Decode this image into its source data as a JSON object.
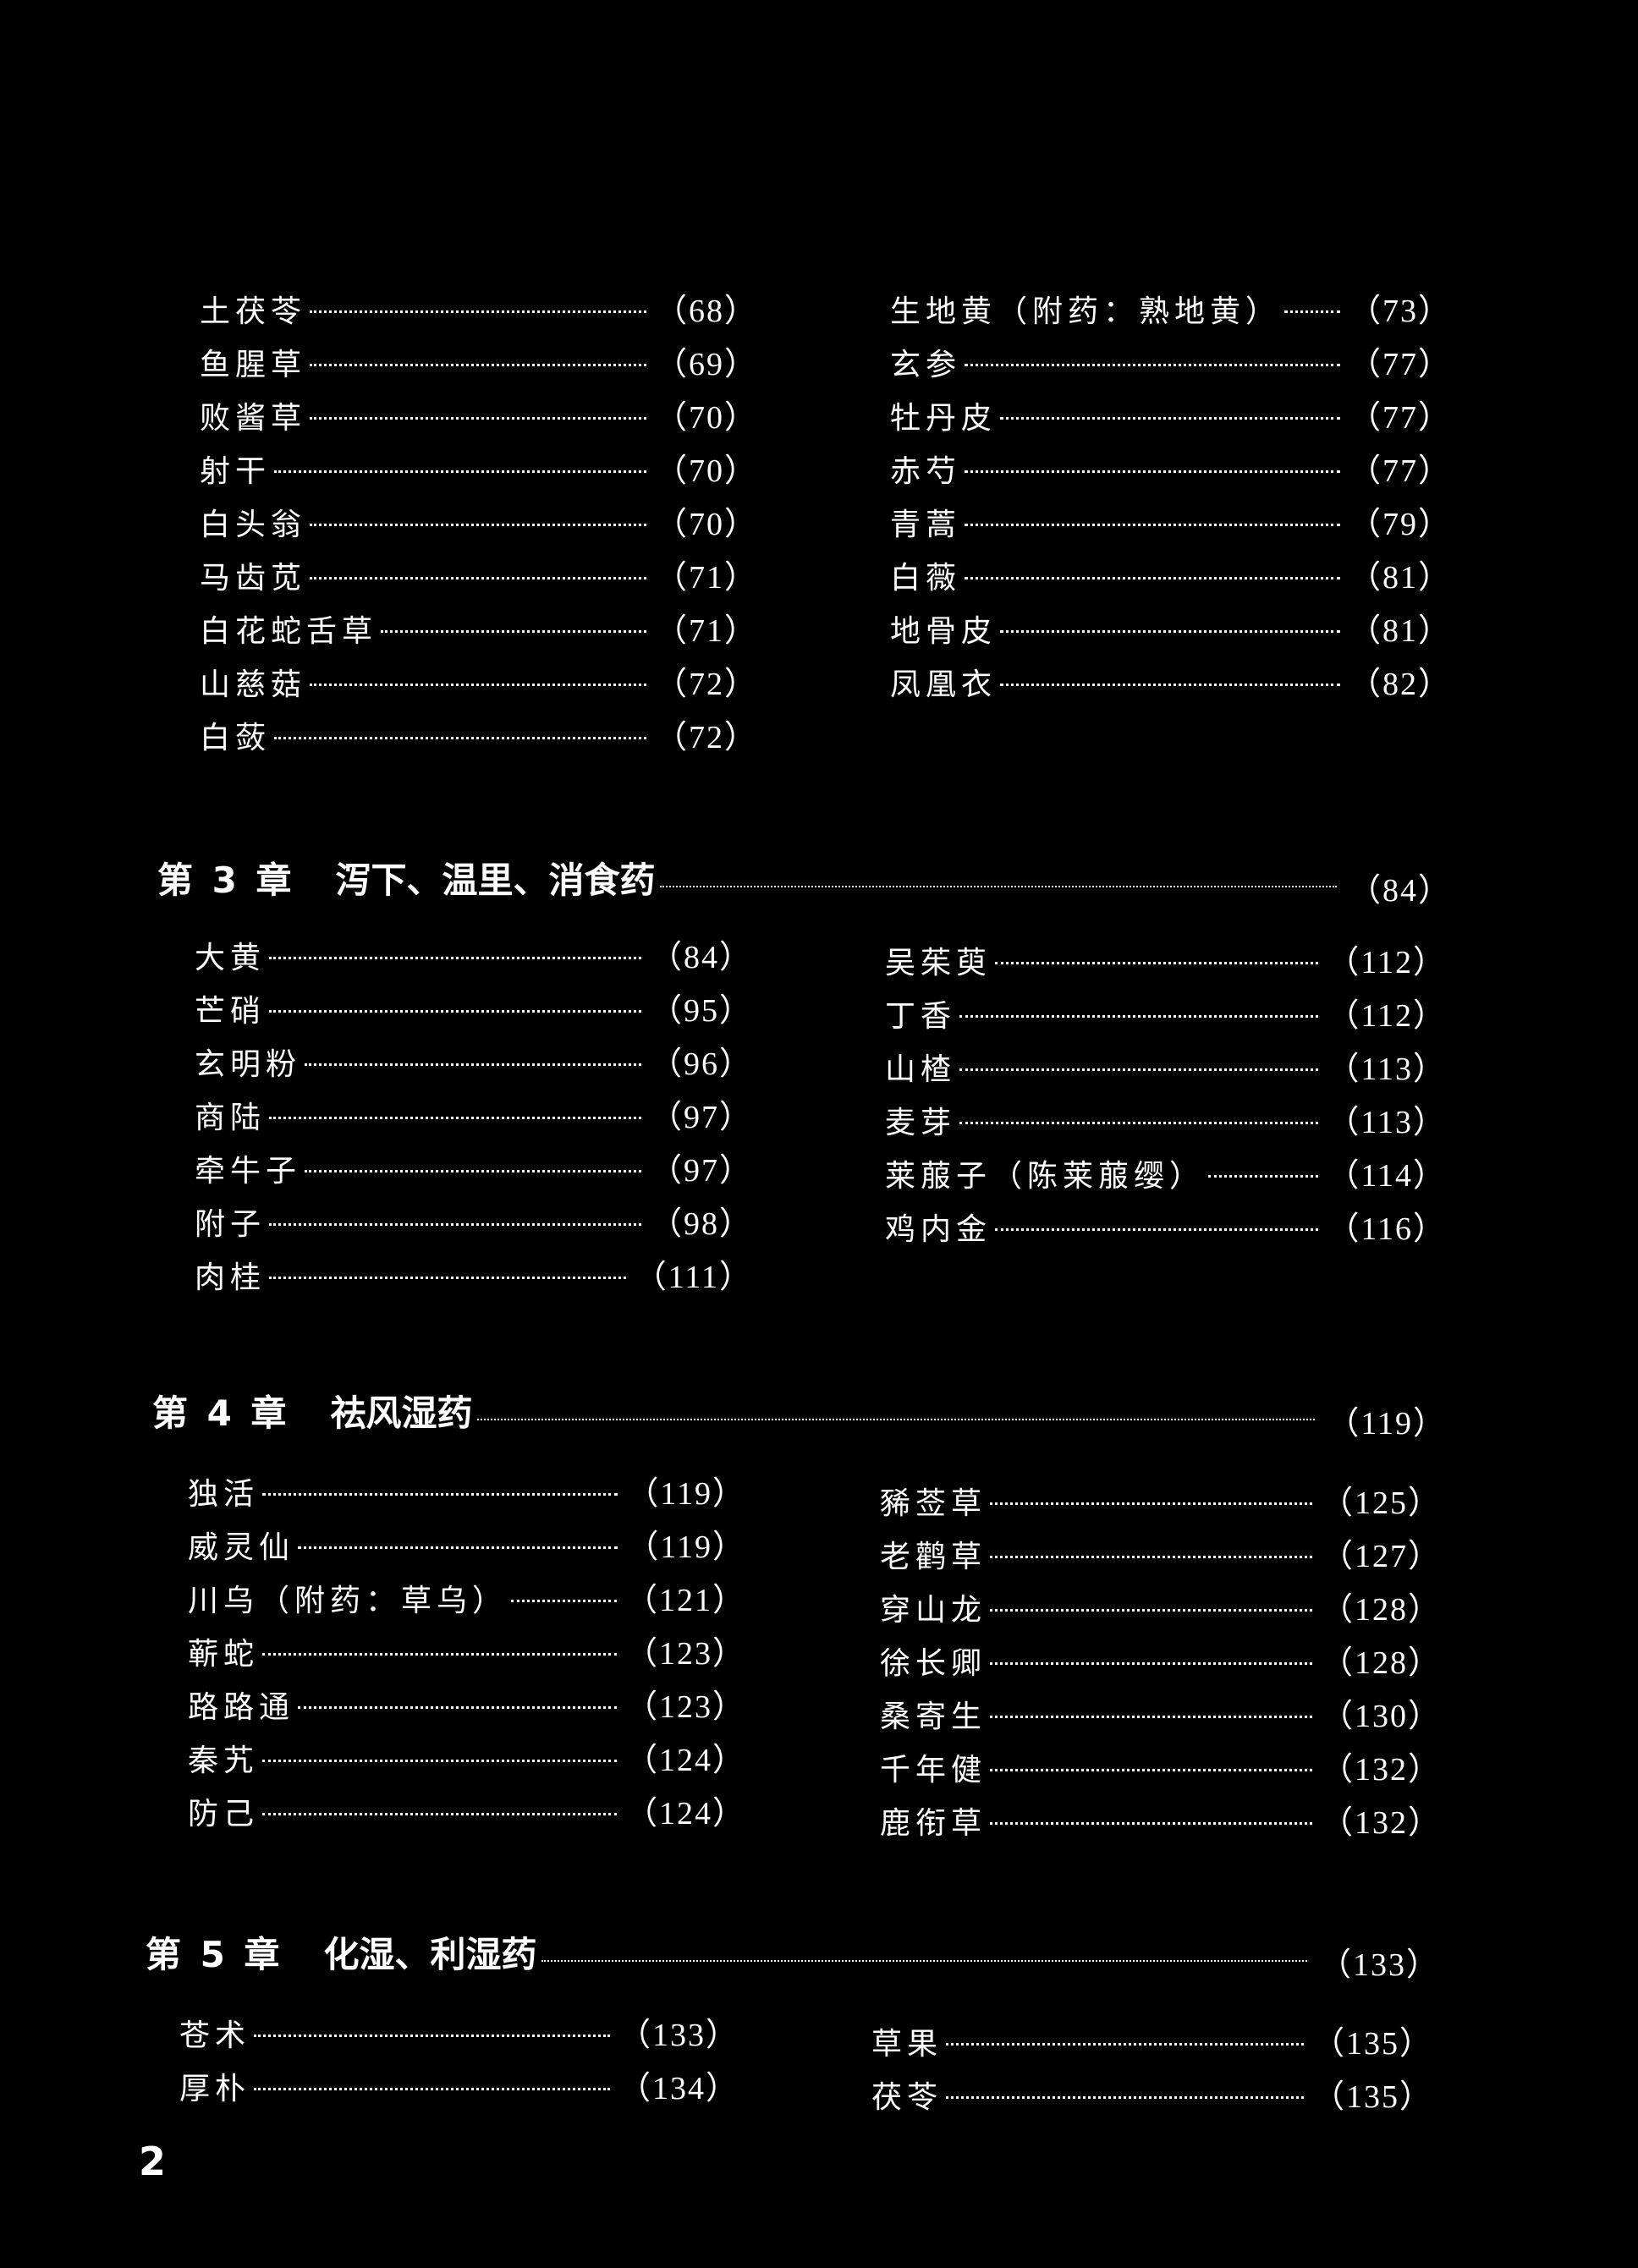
{
  "section_2_tail": {
    "left": [
      {
        "name": "土茯苓",
        "page": "68"
      },
      {
        "name": "鱼腥草",
        "page": "69"
      },
      {
        "name": "败酱草",
        "page": "70"
      },
      {
        "name": "射干",
        "page": "70"
      },
      {
        "name": "白头翁",
        "page": "70"
      },
      {
        "name": "马齿苋",
        "page": "71"
      },
      {
        "name": "白花蛇舌草",
        "page": "71"
      },
      {
        "name": "山慈菇",
        "page": "72"
      },
      {
        "name": "白蔹",
        "page": "72"
      }
    ],
    "right": [
      {
        "name": "生地黄（附药：熟地黄）",
        "page": "73"
      },
      {
        "name": "玄参",
        "page": "77"
      },
      {
        "name": "牡丹皮",
        "page": "77"
      },
      {
        "name": "赤芍",
        "page": "77"
      },
      {
        "name": "青蒿",
        "page": "79"
      },
      {
        "name": "白薇",
        "page": "81"
      },
      {
        "name": "地骨皮",
        "page": "81"
      },
      {
        "name": "凤凰衣",
        "page": "82"
      }
    ]
  },
  "chapters": [
    {
      "label": "第 3 章",
      "title": "泻下、温里、消食药",
      "page": "84",
      "left": [
        {
          "name": "大黄",
          "page": "84"
        },
        {
          "name": "芒硝",
          "page": "95"
        },
        {
          "name": "玄明粉",
          "page": "96"
        },
        {
          "name": "商陆",
          "page": "97"
        },
        {
          "name": "牵牛子",
          "page": "97"
        },
        {
          "name": "附子",
          "page": "98"
        },
        {
          "name": "肉桂",
          "page": "111"
        }
      ],
      "right": [
        {
          "name": "吴茱萸",
          "page": "112"
        },
        {
          "name": "丁香",
          "page": "112"
        },
        {
          "name": "山楂",
          "page": "113"
        },
        {
          "name": "麦芽",
          "page": "113"
        },
        {
          "name": "莱菔子（陈莱菔缨）",
          "page": "114"
        },
        {
          "name": "鸡内金",
          "page": "116"
        }
      ]
    },
    {
      "label": "第 4 章",
      "title": "祛风湿药",
      "page": "119",
      "left": [
        {
          "name": "独活",
          "page": "119"
        },
        {
          "name": "威灵仙",
          "page": "119"
        },
        {
          "name": "川乌（附药：草乌）",
          "page": "121"
        },
        {
          "name": "蕲蛇",
          "page": "123"
        },
        {
          "name": "路路通",
          "page": "123"
        },
        {
          "name": "秦艽",
          "page": "124"
        },
        {
          "name": "防己",
          "page": "124"
        }
      ],
      "right": [
        {
          "name": "豨莶草",
          "page": "125"
        },
        {
          "name": "老鹳草",
          "page": "127"
        },
        {
          "name": "穿山龙",
          "page": "128"
        },
        {
          "name": "徐长卿",
          "page": "128"
        },
        {
          "name": "桑寄生",
          "page": "130"
        },
        {
          "name": "千年健",
          "page": "132"
        },
        {
          "name": "鹿衔草",
          "page": "132"
        }
      ]
    },
    {
      "label": "第 5 章",
      "title": "化湿、利湿药",
      "page": "133",
      "left": [
        {
          "name": "苍术",
          "page": "133"
        },
        {
          "name": "厚朴",
          "page": "134"
        }
      ],
      "right": [
        {
          "name": "草果",
          "page": "135"
        },
        {
          "name": "茯苓",
          "page": "135"
        }
      ]
    }
  ],
  "folio": "2"
}
